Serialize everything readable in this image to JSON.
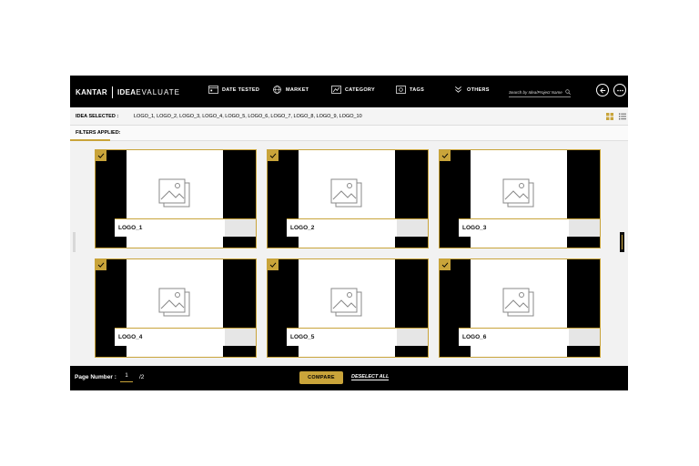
{
  "header": {
    "brand": "KANTAR",
    "app_name_bold": "IDEA",
    "app_name_rest": "EVALUATE",
    "nav": [
      {
        "label": "DATE TESTED",
        "icon": "calendar-icon"
      },
      {
        "label": "MARKET",
        "icon": "globe-icon"
      },
      {
        "label": "CATEGORY",
        "icon": "category-icon"
      },
      {
        "label": "TAGS",
        "icon": "tag-icon"
      },
      {
        "label": "OTHERS",
        "icon": "chevrons-down-icon"
      }
    ],
    "search_placeholder": "Search by Idea/Project Name"
  },
  "selection": {
    "label": "IDEA SELECTED :",
    "value": "LOGO_1, LOGO_2, LOGO_3, LOGO_4, LOGO_5, LOGO_6, LOGO_7, LOGO_8, LOGO_9, LOGO_10"
  },
  "filters": {
    "label": "FILTERS APPLIED:"
  },
  "cards": [
    {
      "name": "LOGO_1",
      "checked": true
    },
    {
      "name": "LOGO_2",
      "checked": true
    },
    {
      "name": "LOGO_3",
      "checked": true
    },
    {
      "name": "LOGO_4",
      "checked": true
    },
    {
      "name": "LOGO_5",
      "checked": true
    },
    {
      "name": "LOGO_6",
      "checked": true
    }
  ],
  "footer": {
    "page_label": "Page Number :",
    "page_current": "1",
    "page_total": "/2",
    "compare_label": "COMPARE",
    "deselect_label": "DESELECT ALL"
  },
  "colors": {
    "accent": "#c9a43a",
    "bar": "#000000",
    "background": "#f2f2f2"
  }
}
